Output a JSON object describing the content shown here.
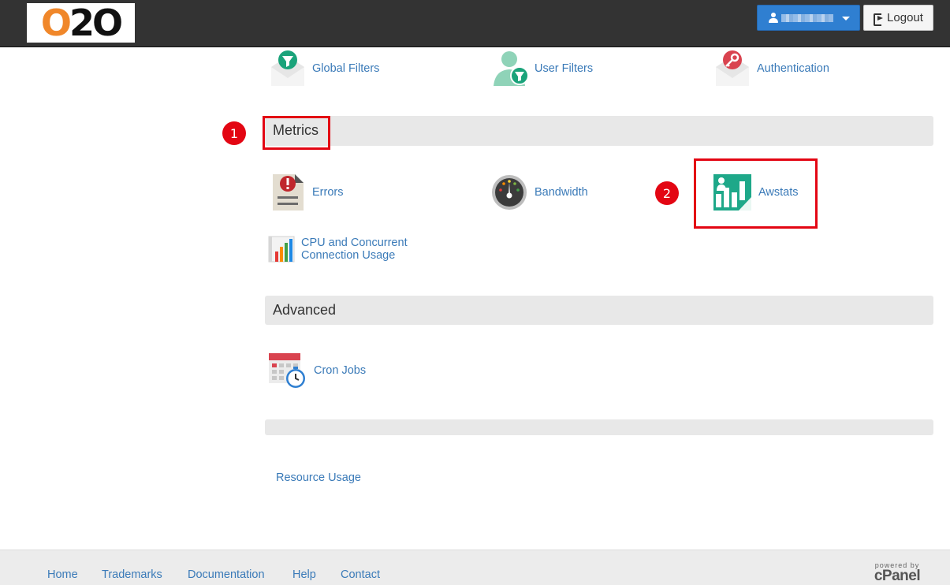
{
  "header": {
    "logo_text": "O2O",
    "logout_label": "Logout"
  },
  "email_section": {
    "items": [
      {
        "label": "Global Filters",
        "icon": "funnel-envelope-icon"
      },
      {
        "label": "User Filters",
        "icon": "user-funnel-icon"
      },
      {
        "label": "Authentication",
        "icon": "key-envelope-icon"
      }
    ]
  },
  "metrics_section": {
    "title": "Metrics",
    "items": [
      {
        "label": "Errors",
        "icon": "error-document-icon"
      },
      {
        "label": "Bandwidth",
        "icon": "gauge-icon"
      },
      {
        "label": "Awstats",
        "icon": "awstats-chart-icon"
      },
      {
        "label_line1": "CPU and Concurrent",
        "label_line2": "Connection Usage",
        "icon": "cpu-bar-chart-icon"
      }
    ]
  },
  "advanced_section": {
    "title": "Advanced",
    "items": [
      {
        "label": "Cron Jobs",
        "icon": "calendar-clock-icon"
      }
    ]
  },
  "stats_link": "Resource Usage",
  "annotations": {
    "step1": "1",
    "step2": "2",
    "color": "#e30613"
  },
  "footer": {
    "links": [
      "Home",
      "Trademarks",
      "Documentation",
      "Help",
      "Contact"
    ],
    "powered_line1": "powered by",
    "powered_line2": "cPanel"
  },
  "colors": {
    "topbar": "#333333",
    "accent_blue": "#2f7fd1",
    "link": "#3a7ab8",
    "section_bg": "#e8e8e8"
  }
}
